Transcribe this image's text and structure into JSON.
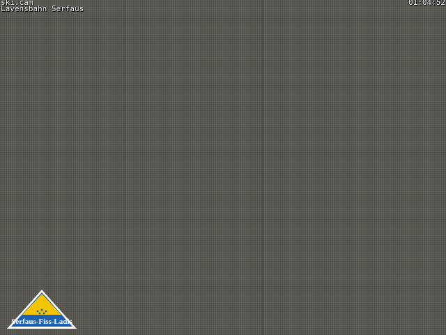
{
  "overlay": {
    "site": "ski.cam",
    "location": "Lavensbahn Serfaus",
    "time": "01:04:52"
  },
  "logo": {
    "text": "Serfaus-Fiss-Ladis",
    "colors": {
      "triangle": "#f2c500",
      "border": "#ffffff",
      "band": "#1f5fb0"
    }
  },
  "colors": {
    "night_sky": "#5b5a52"
  }
}
